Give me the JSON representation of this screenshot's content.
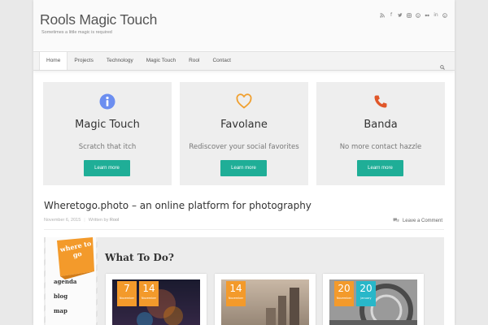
{
  "site": {
    "title": "Rools Magic Touch",
    "description": "Sometimes a little magic is required",
    "social_icons": [
      "rss-icon",
      "facebook-icon",
      "twitter-icon",
      "instagram-icon",
      "skype-icon",
      "flickr-icon",
      "linkedin-icon",
      "pinterest-icon"
    ]
  },
  "nav": {
    "items": [
      "Home",
      "Projects",
      "Technology",
      "Magic Touch",
      "Rool",
      "Contact"
    ],
    "active": "Home"
  },
  "features": [
    {
      "icon": "info-icon",
      "title": "Magic Touch",
      "subtitle": "Scratch that itch",
      "button": "Learn more",
      "color": "#6c8ef0"
    },
    {
      "icon": "heart-icon",
      "title": "Favolane",
      "subtitle": "Rediscover your social favorites",
      "button": "Learn more",
      "color": "#f0a030"
    },
    {
      "icon": "phone-icon",
      "title": "Banda",
      "subtitle": "No more contact hazzle",
      "button": "Learn more",
      "color": "#e0572a"
    }
  ],
  "post": {
    "title": "Wheretogo.photo – an online platform for photography",
    "date": "November 6, 2015",
    "written_by": "Written by",
    "author": "Rool",
    "comments": "Leave a Comment"
  },
  "featured_image": {
    "logo": "where to go",
    "logo_small": "photo",
    "side_links": [
      "agenda",
      "blog",
      "map"
    ],
    "heading": "What To Do?",
    "cards": [
      {
        "dates": [
          {
            "day": "7",
            "month": "November"
          },
          {
            "day": "14",
            "month": "November"
          }
        ]
      },
      {
        "dates": [
          {
            "day": "14",
            "month": "November"
          }
        ]
      },
      {
        "dates": [
          {
            "day": "20",
            "month": "November"
          },
          {
            "day": "20",
            "month": "January"
          }
        ]
      }
    ]
  },
  "colors": {
    "accent": "#1fae97",
    "brand_orange": "#f39a2b",
    "date_teal": "#28b7c9"
  }
}
